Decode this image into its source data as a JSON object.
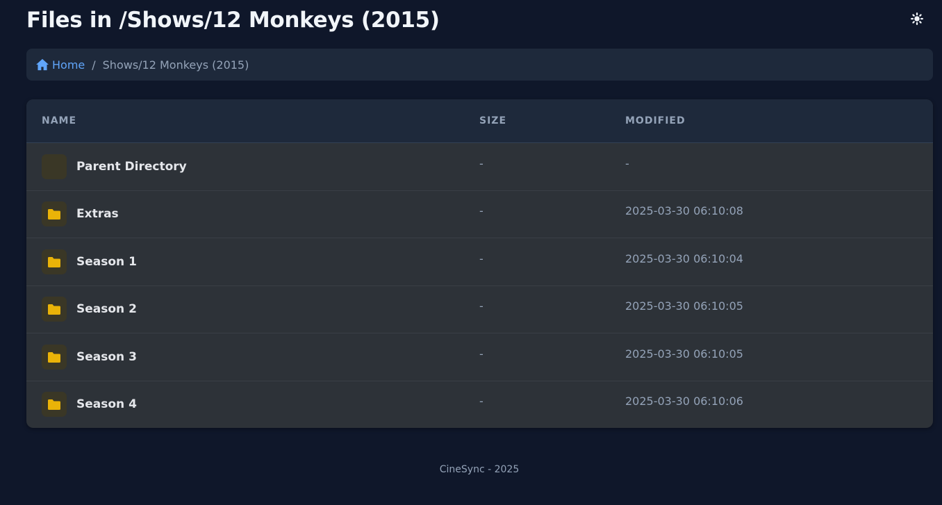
{
  "header": {
    "title": "Files in /Shows/12 Monkeys (2015)",
    "theme_icon": "sun-icon"
  },
  "breadcrumb": {
    "home_icon": "home-icon",
    "home_label": "Home",
    "separator": "/",
    "current": "Shows/12 Monkeys (2015)"
  },
  "table": {
    "columns": [
      "NAME",
      "SIZE",
      "MODIFIED"
    ],
    "rows": [
      {
        "name": "Parent Directory",
        "size": "-",
        "modified": "-",
        "icon": "parent-directory-icon"
      },
      {
        "name": "Extras",
        "size": "-",
        "modified": "2025-03-30 06:10:08",
        "icon": "folder-icon"
      },
      {
        "name": "Season 1",
        "size": "-",
        "modified": "2025-03-30 06:10:04",
        "icon": "folder-icon"
      },
      {
        "name": "Season 2",
        "size": "-",
        "modified": "2025-03-30 06:10:05",
        "icon": "folder-icon"
      },
      {
        "name": "Season 3",
        "size": "-",
        "modified": "2025-03-30 06:10:05",
        "icon": "folder-icon"
      },
      {
        "name": "Season 4",
        "size": "-",
        "modified": "2025-03-30 06:10:06",
        "icon": "folder-icon"
      }
    ]
  },
  "footer": {
    "text": "CineSync - 2025"
  },
  "colors": {
    "background": "#0f172a",
    "card": "#1e293b",
    "link": "#60a5fa",
    "folder": "#eab308"
  }
}
